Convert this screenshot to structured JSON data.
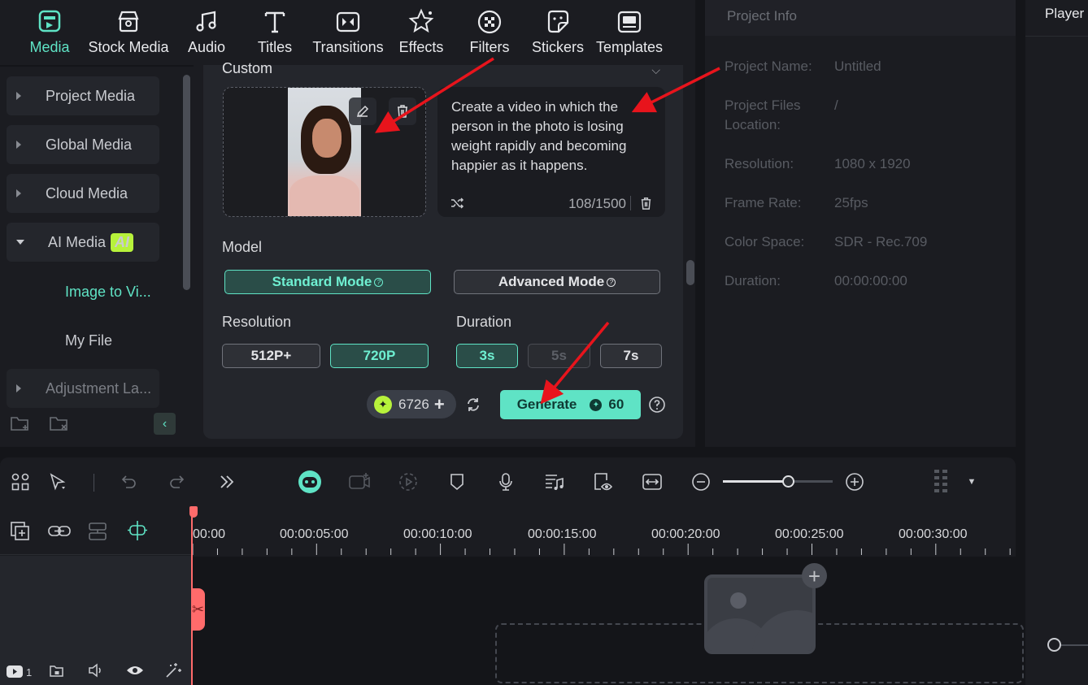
{
  "toolbar": {
    "items": [
      {
        "label": "Media",
        "icon": "media-icon",
        "active": true
      },
      {
        "label": "Stock Media",
        "icon": "stock-media-icon"
      },
      {
        "label": "Audio",
        "icon": "audio-icon"
      },
      {
        "label": "Titles",
        "icon": "titles-icon"
      },
      {
        "label": "Transitions",
        "icon": "transitions-icon"
      },
      {
        "label": "Effects",
        "icon": "effects-icon"
      },
      {
        "label": "Filters",
        "icon": "filters-icon"
      },
      {
        "label": "Stickers",
        "icon": "stickers-icon"
      },
      {
        "label": "Templates",
        "icon": "templates-icon"
      }
    ]
  },
  "sidebar": {
    "items": [
      {
        "label": "Project Media"
      },
      {
        "label": "Global Media"
      },
      {
        "label": "Cloud Media"
      },
      {
        "label": "AI Media",
        "badge": "AI"
      },
      {
        "label": "Adjustment La..."
      }
    ],
    "sub_items": [
      {
        "label": "Image to Vi...",
        "active": true
      },
      {
        "label": "My File"
      }
    ]
  },
  "panel": {
    "section_label": "Custom",
    "prompt": "Create a video in which the person in the photo is losing weight rapidly and becoming happier as it happens.",
    "prompt_count": "108/1500",
    "model_label": "Model",
    "modes": [
      {
        "label": "Standard Mode",
        "active": true
      },
      {
        "label": "Advanced Mode",
        "active": false
      }
    ],
    "resolution_label": "Resolution",
    "resolutions": [
      {
        "label": "512P+",
        "active": false
      },
      {
        "label": "720P",
        "active": true
      }
    ],
    "duration_label": "Duration",
    "durations": [
      {
        "label": "3s",
        "state": "active"
      },
      {
        "label": "5s",
        "state": "disabled"
      },
      {
        "label": "7s",
        "state": "normal"
      }
    ],
    "credits": "6726",
    "generate_label": "Generate",
    "generate_cost": "60"
  },
  "project_info": {
    "title": "Project Info",
    "rows": [
      {
        "label": "Project Name:",
        "value": "Untitled"
      },
      {
        "label": "Project Files Location:",
        "value": "/"
      },
      {
        "label": "Resolution:",
        "value": "1080 x 1920"
      },
      {
        "label": "Frame Rate:",
        "value": "25fps"
      },
      {
        "label": "Color Space:",
        "value": "SDR - Rec.709"
      },
      {
        "label": "Duration:",
        "value": "00:00:00:00"
      }
    ]
  },
  "player": {
    "title": "Player"
  },
  "timeline": {
    "ruler": [
      "00:00",
      "00:00:05:00",
      "00:00:10:00",
      "00:00:15:00",
      "00:00:20:00",
      "00:00:25:00",
      "00:00:30:00"
    ],
    "track_count": "1",
    "zoom_level": 0.6
  },
  "colors": {
    "accent": "#5fe3c5",
    "playhead": "#ff6b6b",
    "annotation_arrow": "#e8141c",
    "ai_badge": "#b7f23b"
  }
}
